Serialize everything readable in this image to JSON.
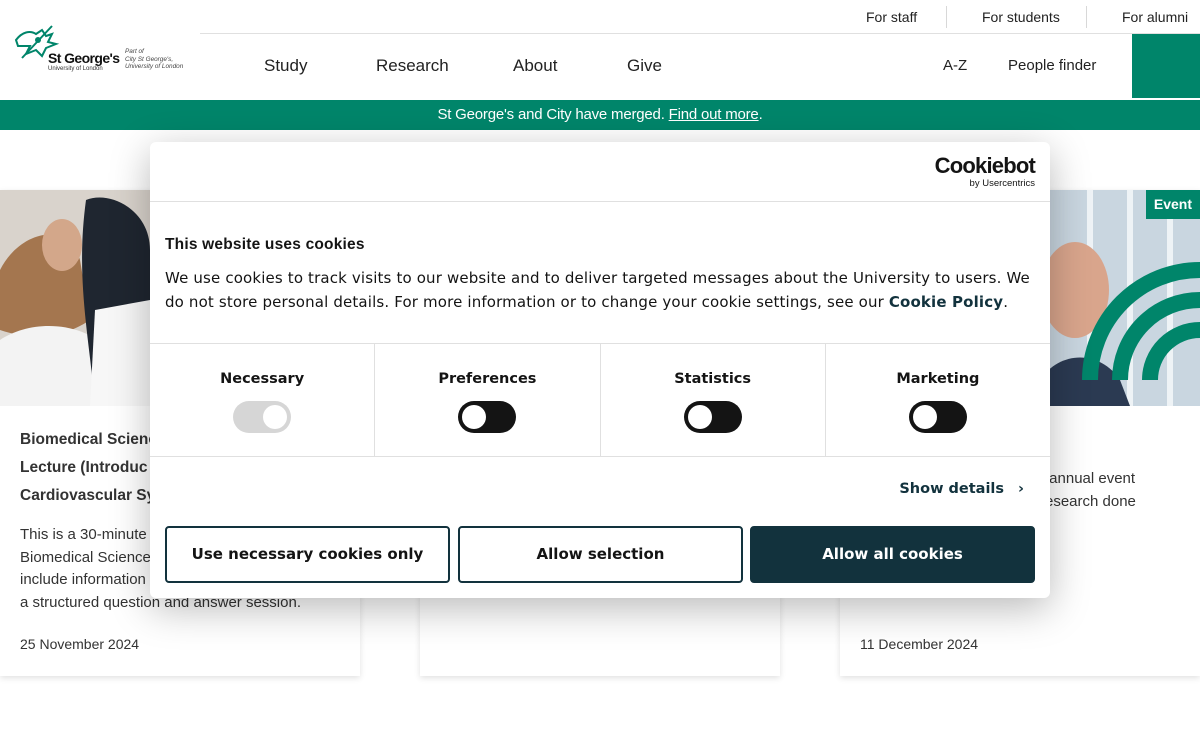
{
  "utility_nav": {
    "for_staff": "For staff",
    "for_students": "For students",
    "for_alumni": "For alumni"
  },
  "logo": {
    "brand": "St George's",
    "brand_sub": "University of London",
    "part_of_line1": "Part of",
    "part_of_line2": "City St George's,",
    "part_of_line3": "University of London"
  },
  "main_nav": {
    "study": "Study",
    "research": "Research",
    "about": "About",
    "give": "Give",
    "a_z": "A-Z",
    "people_finder": "People finder"
  },
  "banner": {
    "text": "St George's and City have merged.",
    "link": "Find out more",
    "end": "."
  },
  "cards": [
    {
      "title_line1": "Biomedical Science",
      "title_line2": "Lecture (Introduc",
      "title_line3": "Cardiovascular Sy",
      "description": "This is a 30-minute Biomedical Science include information a structured question and answer session.",
      "desc_line1": "This is a 30-minute",
      "desc_line2": "Biomedical Science",
      "desc_line3": "include information",
      "desc_line4": "a structured question and answer session.",
      "date": "25 November 2024"
    },
    {
      "date": ""
    },
    {
      "badge": "Event",
      "desc_line1": "r annual event",
      "desc_line2": "research done",
      "date": "11 December 2024"
    }
  ],
  "cookie_dialog": {
    "provider_name": "Cookiebot",
    "provider_by": "by Usercentrics",
    "title": "This website uses cookies",
    "body": "We use cookies to track visits to our website and to deliver targeted messages about the University to users. We do not store personal details. For more information or to change your cookie settings, see our ",
    "policy_link": "Cookie Policy",
    "body_end": ".",
    "categories": [
      {
        "label": "Necessary",
        "enabled": true,
        "locked": true
      },
      {
        "label": "Preferences",
        "enabled": false,
        "locked": false
      },
      {
        "label": "Statistics",
        "enabled": false,
        "locked": false
      },
      {
        "label": "Marketing",
        "enabled": false,
        "locked": false
      }
    ],
    "show_details": "Show details",
    "buttons": {
      "necessary_only": "Use necessary cookies only",
      "allow_selection": "Allow selection",
      "allow_all": "Allow all cookies"
    }
  },
  "colors": {
    "brand_green": "#00856a",
    "dialog_dark": "#12323d"
  }
}
